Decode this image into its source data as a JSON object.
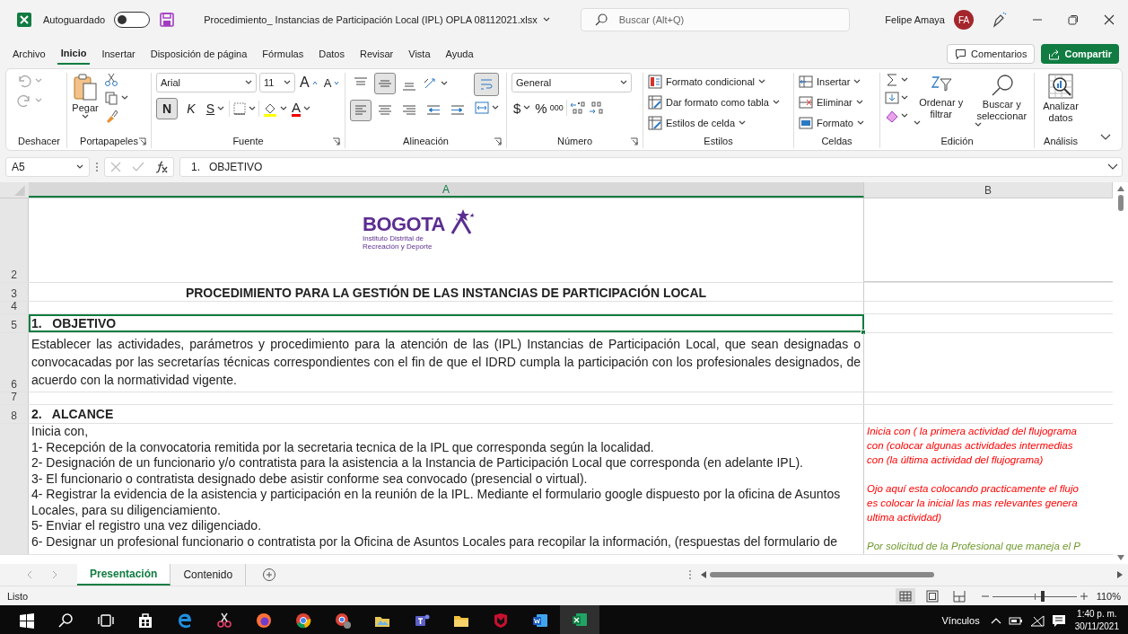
{
  "titlebar": {
    "autosave_label": "Autoguardado",
    "autosave_on": false,
    "filename": "Procedimiento_ Instancias de Participación Local (IPL) OPLA 08112021.xlsx",
    "search_placeholder": "Buscar (Alt+Q)",
    "user_name": "Felipe Amaya",
    "user_initials": "FA"
  },
  "menu_tabs": [
    {
      "label": "Archivo",
      "selected": false
    },
    {
      "label": "Inicio",
      "selected": true
    },
    {
      "label": "Insertar",
      "selected": false
    },
    {
      "label": "Disposición de página",
      "selected": false
    },
    {
      "label": "Fórmulas",
      "selected": false
    },
    {
      "label": "Datos",
      "selected": false
    },
    {
      "label": "Revisar",
      "selected": false
    },
    {
      "label": "Vista",
      "selected": false
    },
    {
      "label": "Ayuda",
      "selected": false
    }
  ],
  "header_buttons": [
    {
      "kind": "comments",
      "label": "Comentarios"
    },
    {
      "kind": "share",
      "label": "Compartir"
    }
  ],
  "ribbon": {
    "groups": [
      {
        "kind": "undo",
        "label": "Deshacer"
      },
      {
        "kind": "clipboard",
        "label": "Portapapeles",
        "paste_label": "Pegar"
      },
      {
        "kind": "font",
        "label": "Fuente",
        "font": "Arial",
        "size": "11",
        "grow_label": "A",
        "shrink_label": "A",
        "bold_label": "N",
        "bold": true,
        "italic_label": "K",
        "underline_label": "S",
        "color_label": "A"
      },
      {
        "kind": "alignment",
        "label": "Alineación",
        "middle_align": true,
        "left_align": true,
        "wrap_text": true
      },
      {
        "kind": "number",
        "label": "Número",
        "format": "General",
        "currency": "$",
        "percent": "%",
        "thousands": "000"
      },
      {
        "kind": "styles",
        "label": "Estilos",
        "items": [
          "Formato condicional",
          "Dar formato como tabla",
          "Estilos de celda"
        ]
      },
      {
        "kind": "cells",
        "label": "Celdas",
        "items": [
          "Insertar",
          "Eliminar",
          "Formato"
        ]
      },
      {
        "kind": "editing",
        "label": "Edición",
        "items": [
          "Ordenar y filtrar",
          "Buscar y seleccionar"
        ]
      },
      {
        "kind": "analysis",
        "label": "Análisis",
        "items": [
          "Analizar datos"
        ]
      }
    ]
  },
  "formula_bar": {
    "name_box": "A5",
    "formula": "1.   OBJETIVO"
  },
  "sheet": {
    "columns": [
      {
        "label": "A",
        "selected": true
      },
      {
        "label": "B",
        "selected": false
      }
    ],
    "rows": [
      {
        "number": "2",
        "kind": "logo",
        "logo_text": "BOGOTA",
        "logo_sub": "Instituto Distrital de Recreación y Deporte"
      },
      {
        "number": "3",
        "kind": "title",
        "text": "PROCEDIMIENTO PARA LA GESTIÓN DE LAS INSTANCIAS DE PARTICIPACIÓN LOCAL"
      },
      {
        "number": "4",
        "kind": "blank"
      },
      {
        "number": "5",
        "kind": "heading",
        "text": "1.   OBJETIVO",
        "selected": true
      },
      {
        "number": "6",
        "kind": "paragraph",
        "text": "Establecer las actividades, parámetros y procedimiento para la atención de las (IPL) Instancias de Participación Local, que sean designadas o convocacadas por las secretarías técnicas correspondientes con el fin de que el IDRD cumpla la participación con los profesionales designados, de acuerdo con la normatividad vigente."
      },
      {
        "number": "7",
        "kind": "blank"
      },
      {
        "number": "8",
        "kind": "heading",
        "text": "2.   ALCANCE",
        "selected": false
      },
      {
        "kind": "lines",
        "lines": [
          "Inicia con,",
          "1- Recepción de la convocatoria remitida por la secretaria tecnica de la IPL que corresponda según la localidad.",
          "2- Designación de un funcionario y/o contratista para la asistencia a la Instancia de Participación Local que corresponda (en adelante IPL).",
          "3- El funcionario o contratista designado debe asistir conforme sea convocado (presencial o virtual).",
          "4- Registrar la evidencia de la asistencia y participación en la reunión de la IPL. Mediante el formulario google dispuesto por la oficina de Asuntos Locales,  para su diligenciamiento.",
          "5- Enviar el registro una vez diligenciado.",
          "6- Designar un profesional funcionario o contratista por la Oficina de Asuntos Locales para recopilar la información, (respuestas del formulario de"
        ],
        "notes": [
          {
            "color": "#ff0000",
            "lines": [
              "Inicia con ( la primera actividad del flujograma",
              "con (colocar algunas actividades intermedias",
              "con (la última actividad del flujograma)"
            ]
          },
          {
            "color": "#ff0000",
            "lines": [
              "Ojo aquí esta colocando practicamente el flujo",
              "es colocar la inicial las mas relevantes genera",
              "ultima actividad)"
            ]
          },
          {
            "color": "#6f9a2e",
            "lines": [
              "Por solicitud de la Profesional que maneja el P"
            ]
          }
        ]
      }
    ]
  },
  "sheet_tabs": [
    {
      "label": "Presentación",
      "selected": true
    },
    {
      "label": "Contenido",
      "selected": false
    }
  ],
  "status_bar": {
    "text": "Listo",
    "views": [
      {
        "kind": "normal",
        "selected": true
      },
      {
        "kind": "page_layout",
        "selected": false
      },
      {
        "kind": "page_break",
        "selected": false
      }
    ],
    "zoom": {
      "label": "110%",
      "level": 0.6
    }
  },
  "taskbar": {
    "apps": [
      {
        "kind": "start",
        "selected": false
      },
      {
        "kind": "search",
        "selected": false
      },
      {
        "kind": "taskview",
        "selected": false
      },
      {
        "kind": "store",
        "selected": false
      },
      {
        "kind": "edge",
        "selected": false
      },
      {
        "kind": "snip",
        "selected": false
      },
      {
        "kind": "firefox",
        "selected": false
      },
      {
        "kind": "chrome",
        "selected": false
      },
      {
        "kind": "chrome_profile",
        "selected": false
      },
      {
        "kind": "folder_photos",
        "selected": false
      },
      {
        "kind": "teams",
        "selected": false
      },
      {
        "kind": "explorer",
        "selected": false
      },
      {
        "kind": "shield",
        "selected": false
      },
      {
        "kind": "word",
        "selected": false
      },
      {
        "kind": "excel",
        "selected": true
      }
    ],
    "links_label": "Vínculos",
    "time": "1:40 p. m.",
    "date": "30/11/2021"
  }
}
